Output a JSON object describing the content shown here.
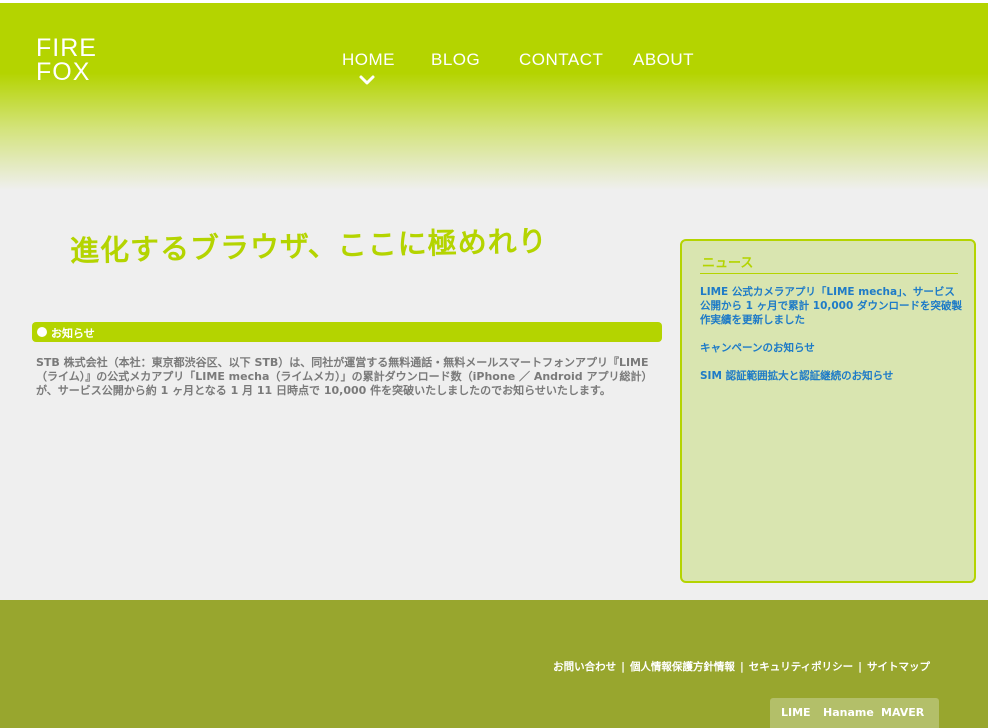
{
  "logo": {
    "line1": "FIRE",
    "line2": "FOX"
  },
  "nav": {
    "items": [
      {
        "label": "HOME"
      },
      {
        "label": "BLOG"
      },
      {
        "label": "CONTACT"
      },
      {
        "label": "ABOUT"
      }
    ],
    "active_icon": "chevron-down-icon"
  },
  "headline": "進化するブラウザ、ここに極めれり",
  "notice": {
    "title": "お知らせ",
    "body": "STB 株式会社（本社：東京都渋谷区、以下 STB）は、同社が運営する無料通話・無料メールスマートフォンアプリ『LIME（ライム）』の公式メカアプリ「LIME mecha（ライムメカ）」の累計ダウンロード数（iPhone ／ Android アプリ総計）が、サービス公開から約 1 ヶ月となる 1 月 11 日時点で 10,000 件を突破いたしましたのでお知らせいたします。"
  },
  "news": {
    "title": "ニュース",
    "items": [
      "LIME 公式カメラアプリ「LIME mecha」、サービス公開から 1 ヶ月で累計 10,000 ダウンロードを突破製作実績を更新しました",
      "キャンペーンのお知らせ",
      "SIM 認証範囲拡大と認証継続のお知らせ"
    ]
  },
  "footer": {
    "links": [
      "お問い合わせ",
      "個人情報保護方針情報",
      "セキュリティポリシー",
      "サイトマップ"
    ],
    "separator": "|",
    "brands": [
      "LIME",
      "Haname",
      "MAVER"
    ]
  },
  "colors": {
    "accent": "#b4d400",
    "footer": "#98a62e",
    "link": "#1e7bc7",
    "background": "#efefef"
  }
}
